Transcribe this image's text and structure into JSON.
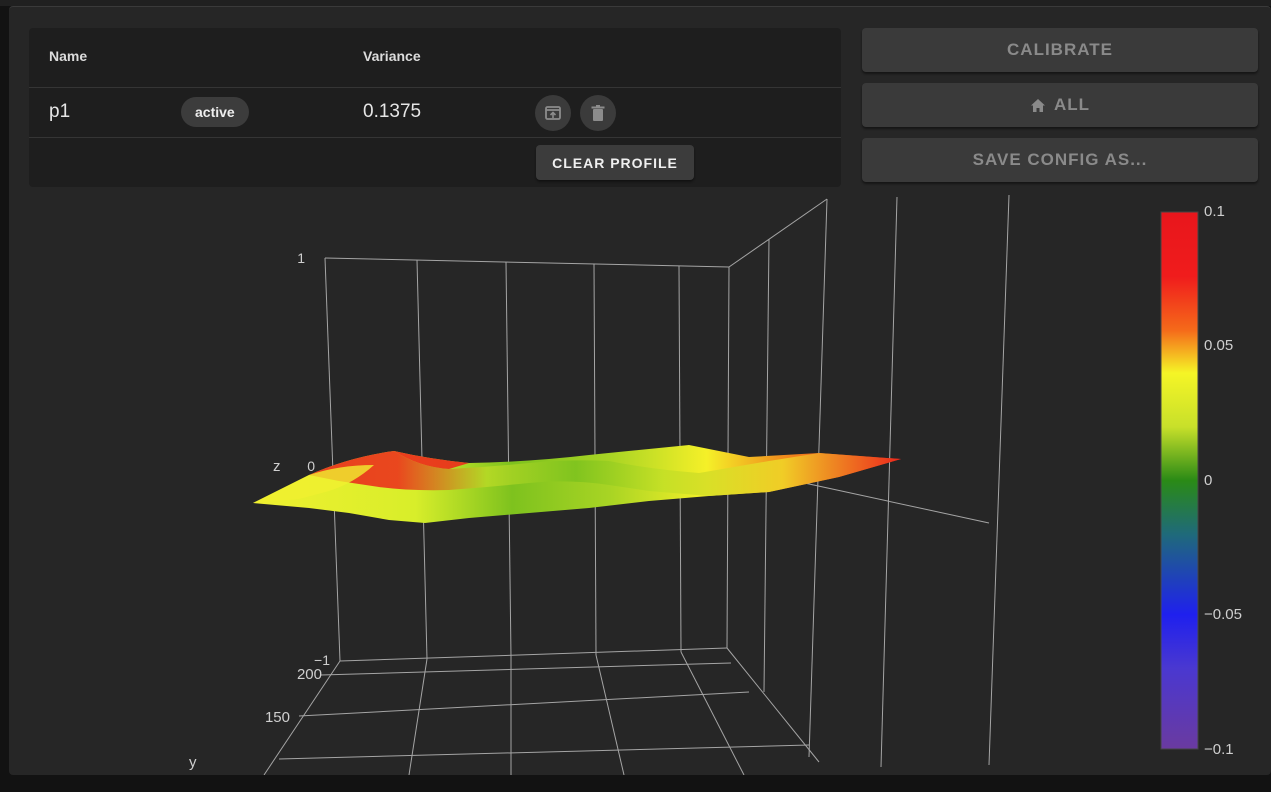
{
  "profiles_table": {
    "headers": {
      "name": "Name",
      "variance": "Variance"
    },
    "rows": [
      {
        "name": "p1",
        "status": "active",
        "variance": "0.1375"
      }
    ],
    "clear_label": "CLEAR PROFILE"
  },
  "actions": {
    "calibrate_label": "CALIBRATE",
    "home_all_label": "ALL",
    "save_config_label": "SAVE CONFIG AS..."
  },
  "plot": {
    "z_axis": {
      "label": "z",
      "ticks": [
        "1",
        "0",
        "−1"
      ]
    },
    "y_axis": {
      "label": "y",
      "ticks": [
        "200",
        "150"
      ]
    },
    "colorbar": {
      "ticks": [
        "0.1",
        "0.05",
        "0",
        "−0.05",
        "−0.1"
      ],
      "colors": [
        "#e8161c",
        "#f5f526",
        "#2a8a16",
        "#1f20ee",
        "#6a3aa0"
      ]
    }
  },
  "icons": {
    "load": "load-profile-icon",
    "delete": "trash-icon",
    "home": "home-icon"
  }
}
